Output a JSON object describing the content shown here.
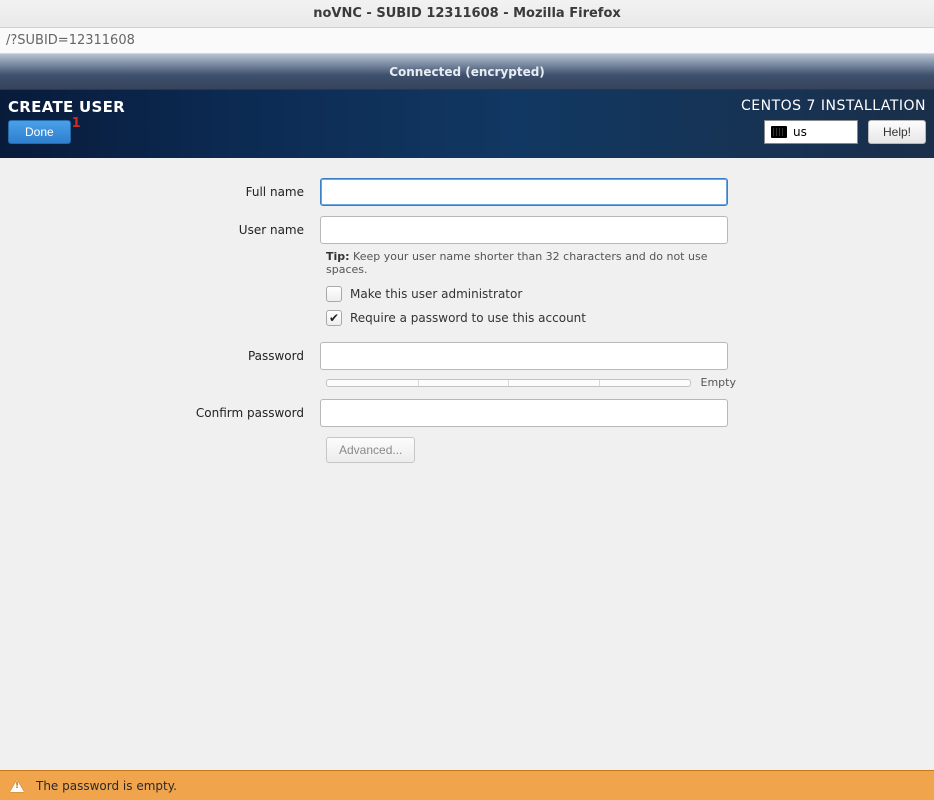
{
  "window": {
    "title": "noVNC - SUBID 12311608 - Mozilla Firefox"
  },
  "url_bar": {
    "text": "/?SUBID=12311608"
  },
  "connection": {
    "status": "Connected (encrypted)"
  },
  "header": {
    "screen_title": "CREATE USER",
    "done_label": "Done",
    "done_badge": "1",
    "install_title": "CENTOS 7 INSTALLATION",
    "keyboard_layout": "us",
    "help_label": "Help!"
  },
  "form": {
    "fullname_label": "Full name",
    "fullname_value": "",
    "username_label": "User name",
    "username_value": "",
    "tip_prefix": "Tip:",
    "tip_text": " Keep your user name shorter than 32 characters and do not use spaces.",
    "admin_checkbox_label": "Make this user administrator",
    "admin_checked": false,
    "require_pw_label": "Require a password to use this account",
    "require_pw_checked": true,
    "password_label": "Password",
    "password_value": "",
    "strength_label": "Empty",
    "confirm_label": "Confirm password",
    "confirm_value": "",
    "advanced_label": "Advanced..."
  },
  "warning": {
    "message": "The password is empty."
  }
}
